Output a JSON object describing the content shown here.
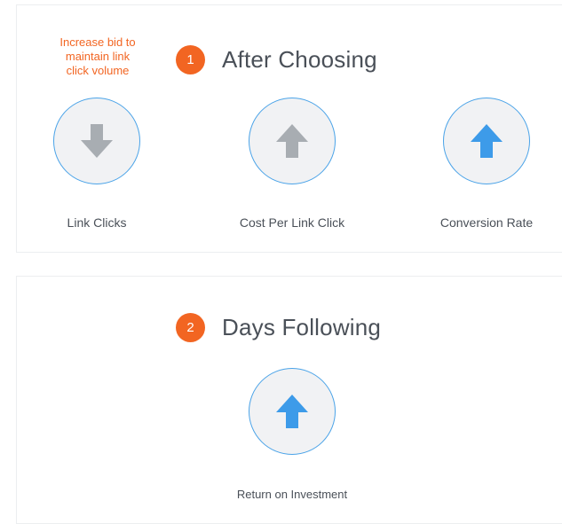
{
  "note": {
    "line1": "Increase bid to",
    "line2": "maintain link",
    "line3": "click volume"
  },
  "sections": [
    {
      "number": "1",
      "title": "After Choosing"
    },
    {
      "number": "2",
      "title": "Days Following"
    }
  ],
  "metrics_after": [
    {
      "label": "Link Clicks",
      "direction": "down",
      "icon": "arrow-down-icon",
      "color": "#a8adb2"
    },
    {
      "label": "Cost Per Link Click",
      "direction": "up",
      "icon": "arrow-up-icon",
      "color": "#a8adb2"
    },
    {
      "label": "Conversion Rate",
      "direction": "up",
      "icon": "arrow-up-icon",
      "color": "#3d9be9"
    }
  ],
  "metrics_following": [
    {
      "label": "Return on Investment",
      "direction": "up",
      "icon": "arrow-up-icon",
      "color": "#3d9be9"
    }
  ],
  "colors": {
    "accent": "#f26522",
    "ring": "#4aa3e8",
    "text": "#4a5058"
  }
}
